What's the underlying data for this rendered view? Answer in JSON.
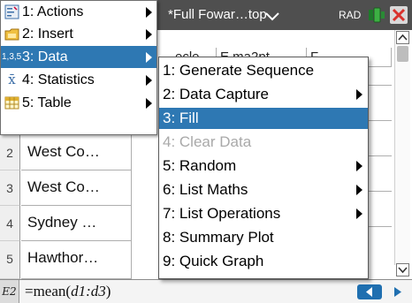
{
  "topbar": {
    "doc_title": "*Full Fowar…top",
    "angle_mode": "RAD",
    "colors": {
      "bar": "#4f4f4f",
      "battery": "#3cb043",
      "close": "#d9312c"
    }
  },
  "sheet": {
    "column_headers": [
      "…ecle",
      "E ma2pt",
      "F"
    ],
    "rows": [
      {
        "num": "2",
        "value": "West Co…"
      },
      {
        "num": "3",
        "value": "West Co…"
      },
      {
        "num": "4",
        "value": "Sydney …"
      },
      {
        "num": "5",
        "value": "Hawthor…"
      }
    ]
  },
  "formula_bar": {
    "cell_ref": "E2",
    "formula_prefix": "=mean",
    "formula_arg": "d1:d3"
  },
  "main_menu": {
    "items": [
      {
        "icon": "actions-icon",
        "label": "1: Actions",
        "has_submenu": true,
        "selected": false
      },
      {
        "icon": "insert-icon",
        "label": "2: Insert",
        "has_submenu": true,
        "selected": false
      },
      {
        "icon": "data-icon",
        "label": "3: Data",
        "has_submenu": true,
        "selected": true
      },
      {
        "icon": "statistics-icon",
        "label": "4: Statistics",
        "has_submenu": true,
        "selected": false
      },
      {
        "icon": "table-icon",
        "label": "5: Table",
        "has_submenu": true,
        "selected": false
      }
    ],
    "icon_glyphs": {
      "data": "1,3,5",
      "statistics": "x̄"
    }
  },
  "data_menu": {
    "items": [
      {
        "label": "1: Generate Sequence",
        "has_submenu": false,
        "state": "normal"
      },
      {
        "label": "2: Data Capture",
        "has_submenu": true,
        "state": "normal"
      },
      {
        "label": "3: Fill",
        "has_submenu": false,
        "state": "selected"
      },
      {
        "label": "4: Clear Data",
        "has_submenu": false,
        "state": "disabled"
      },
      {
        "label": "5: Random",
        "has_submenu": true,
        "state": "normal"
      },
      {
        "label": "6: List Maths",
        "has_submenu": true,
        "state": "normal"
      },
      {
        "label": "7: List Operations",
        "has_submenu": true,
        "state": "normal"
      },
      {
        "label": "8: Summary Plot",
        "has_submenu": false,
        "state": "normal"
      },
      {
        "label": "9: Quick Graph",
        "has_submenu": false,
        "state": "normal"
      }
    ]
  },
  "colors": {
    "accent": "#2e78b3",
    "disabled_text": "#a9a9a9"
  }
}
